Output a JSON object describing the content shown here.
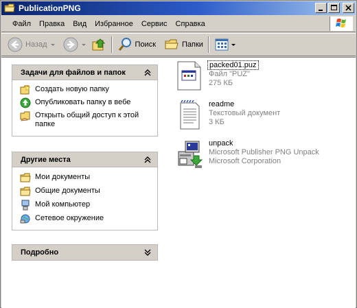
{
  "window": {
    "title": "PublicationPNG"
  },
  "menu": [
    "Файл",
    "Правка",
    "Вид",
    "Избранное",
    "Сервис",
    "Справка"
  ],
  "toolbar": {
    "back_label": "Назад",
    "search_label": "Поиск",
    "folders_label": "Папки"
  },
  "tasks_pane": {
    "title": "Задачи для файлов и папок",
    "items": [
      "Создать новую папку",
      "Опубликовать папку в вебе",
      "Открыть общий доступ к этой папке"
    ]
  },
  "places_pane": {
    "title": "Другие места",
    "items": [
      "Мои документы",
      "Общие документы",
      "Мой компьютер",
      "Сетевое окружение"
    ]
  },
  "details_pane": {
    "title": "Подробно"
  },
  "files": [
    {
      "name": "packed01.puz",
      "type": "Файл \"PUZ\"",
      "info": "275 КБ"
    },
    {
      "name": "readme",
      "type": "Текстовый документ",
      "info": "3 КБ"
    },
    {
      "name": "unpack",
      "type": "Microsoft Publisher PNG Unpack",
      "info": "Microsoft Corporation"
    }
  ]
}
